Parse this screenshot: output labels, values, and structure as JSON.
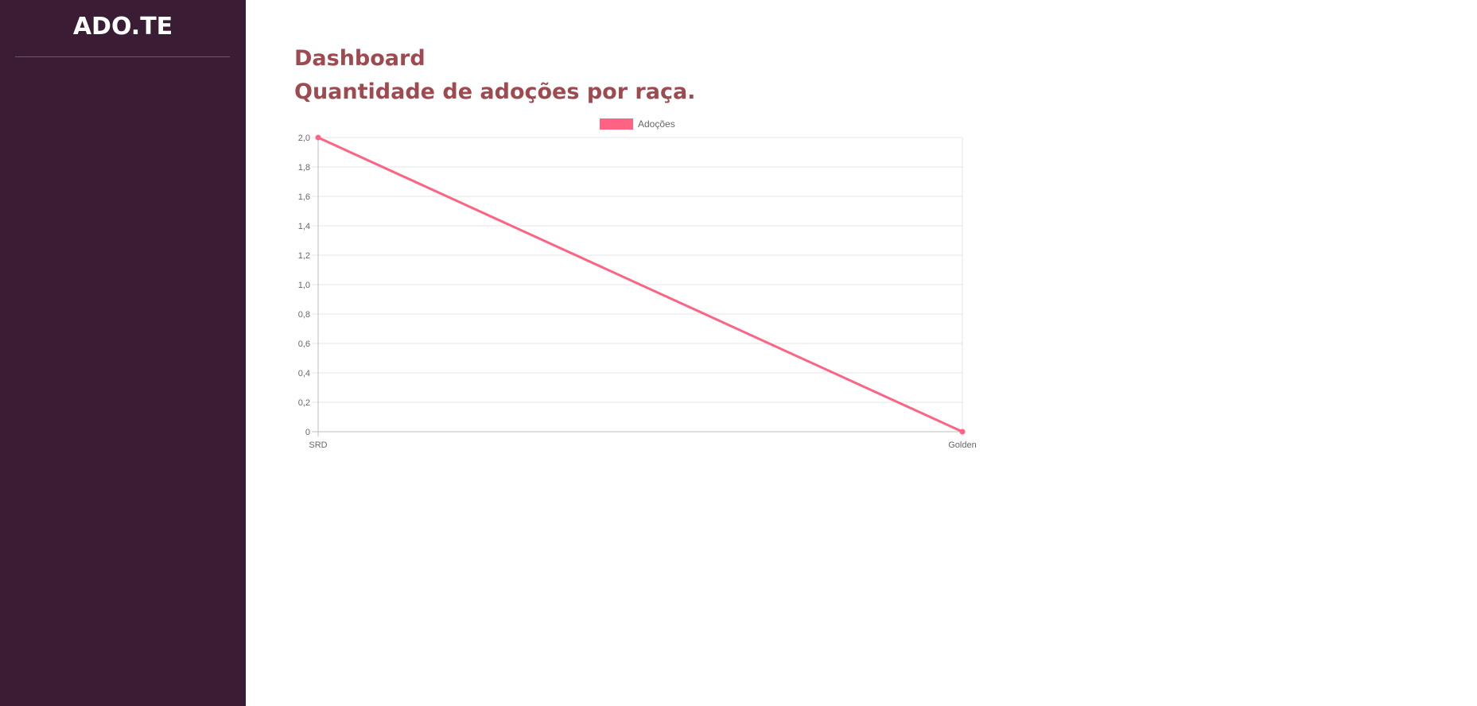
{
  "sidebar": {
    "brand": "ADO.TE"
  },
  "main": {
    "title": "Dashboard",
    "chart_heading": "Quantidade de adoções por raça."
  },
  "colors": {
    "sidebar_bg": "#3a1d34",
    "heading": "#9e4a50",
    "series": "#ff6384"
  },
  "chart_data": {
    "type": "line",
    "categories": [
      "SRD",
      "Golden"
    ],
    "series": [
      {
        "name": "Adoções",
        "values": [
          2,
          0
        ]
      }
    ],
    "ylim": [
      0,
      2
    ],
    "yticks": [
      "0",
      "0,2",
      "0,4",
      "0,6",
      "0,8",
      "1,0",
      "1,2",
      "1,4",
      "1,6",
      "1,8",
      "2,0"
    ],
    "legend_position": "top",
    "grid": true
  }
}
